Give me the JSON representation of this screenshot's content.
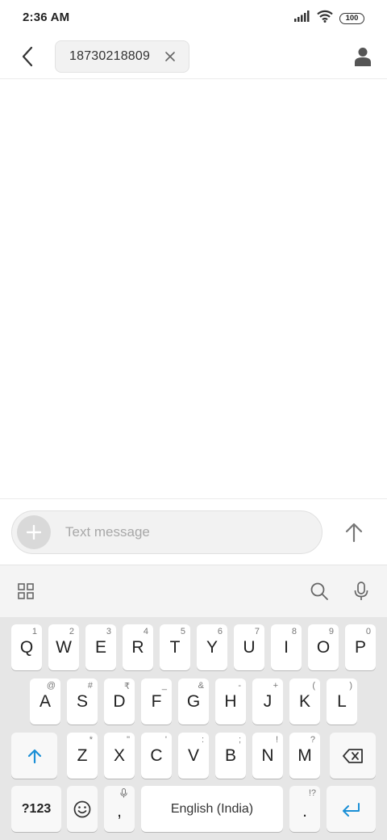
{
  "status": {
    "time": "2:36 AM",
    "battery": "100"
  },
  "header": {
    "recipient": "18730218809"
  },
  "compose": {
    "placeholder": "Text message"
  },
  "keyboard": {
    "row1": [
      {
        "main": "Q",
        "sub": "1"
      },
      {
        "main": "W",
        "sub": "2"
      },
      {
        "main": "E",
        "sub": "3"
      },
      {
        "main": "R",
        "sub": "4"
      },
      {
        "main": "T",
        "sub": "5"
      },
      {
        "main": "Y",
        "sub": "6"
      },
      {
        "main": "U",
        "sub": "7"
      },
      {
        "main": "I",
        "sub": "8"
      },
      {
        "main": "O",
        "sub": "9"
      },
      {
        "main": "P",
        "sub": "0"
      }
    ],
    "row2": [
      {
        "main": "A",
        "sub": "@"
      },
      {
        "main": "S",
        "sub": "#"
      },
      {
        "main": "D",
        "sub": "₹"
      },
      {
        "main": "F",
        "sub": "_"
      },
      {
        "main": "G",
        "sub": "&"
      },
      {
        "main": "H",
        "sub": "-"
      },
      {
        "main": "J",
        "sub": "+"
      },
      {
        "main": "K",
        "sub": "("
      },
      {
        "main": "L",
        "sub": ")"
      }
    ],
    "row3": [
      {
        "main": "Z",
        "sub": "*"
      },
      {
        "main": "X",
        "sub": "\""
      },
      {
        "main": "C",
        "sub": "'"
      },
      {
        "main": "V",
        "sub": ":"
      },
      {
        "main": "B",
        "sub": ";"
      },
      {
        "main": "N",
        "sub": "!"
      },
      {
        "main": "M",
        "sub": "?"
      }
    ],
    "symbols_label": "?123",
    "comma_label": ",",
    "space_label": "English (India)",
    "period_label": ".",
    "period_sub": "!?"
  }
}
